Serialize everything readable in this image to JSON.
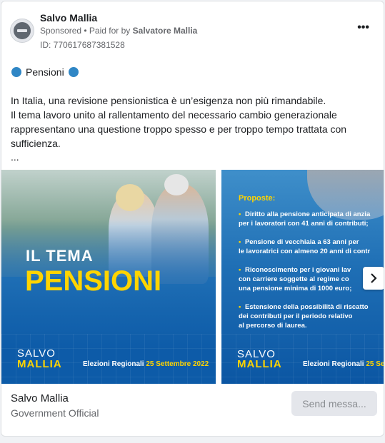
{
  "ad": {
    "page_name": "Salvo Mallia",
    "sponsored": "Sponsored",
    "paid_for_prefix": "• Paid for by",
    "paid_for_by": "Salvatore Mallia",
    "ad_id": "ID: 770617687381528",
    "more_icon": "more-options-icon"
  },
  "post": {
    "headline": "Pensioni",
    "body": [
      "In Italia, una revisione pensionistica è un’esigenza non più rimandabile.",
      "Il tema lavoro unito al rallentamento del necessario cambio generazionale rappresentano una questione troppo spesso e per troppo tempo trattata con sufficienza."
    ],
    "ellipsis": "..."
  },
  "carousel": {
    "slide1": {
      "tema": "IL TEMA",
      "topic": "PENSIONI",
      "brand_top": "SALVO",
      "brand_bottom": "MALLIA",
      "election_label": "Elezioni Regionali",
      "election_date": "25 Settembre 2022"
    },
    "slide2": {
      "heading": "Proposte:",
      "bullets": [
        {
          "l1": "Diritto alla pensione anticipata di anzia",
          "l2": "per i lavoratori con 41 anni di contributi;"
        },
        {
          "l1": "Pensione di vecchiaia a 63 anni per",
          "l2": "le lavoratrici con almeno 20 anni di contr"
        },
        {
          "l1": "Riconoscimento per i giovani lav",
          "l2": "con carriere soggette al regime co",
          "l3": "una pensione minima di 1000 euro;"
        },
        {
          "l1": "Estensione della possibilità di riscatto",
          "l2": "dei contributi per il periodo relativo",
          "l3": "al percorso di laurea."
        }
      ],
      "brand_top": "SALVO",
      "brand_bottom": "MALLIA",
      "election_label": "Elezioni Regionali",
      "election_date": "25 Se"
    },
    "next_icon": "chevron-right-icon"
  },
  "footer": {
    "name": "Salvo Mallia",
    "category": "Government Official",
    "button": "Send messa..."
  },
  "colors": {
    "accent_blue": "#1f6fb5",
    "accent_yellow": "#ffd400",
    "headline_dot": "#2f86c5"
  }
}
